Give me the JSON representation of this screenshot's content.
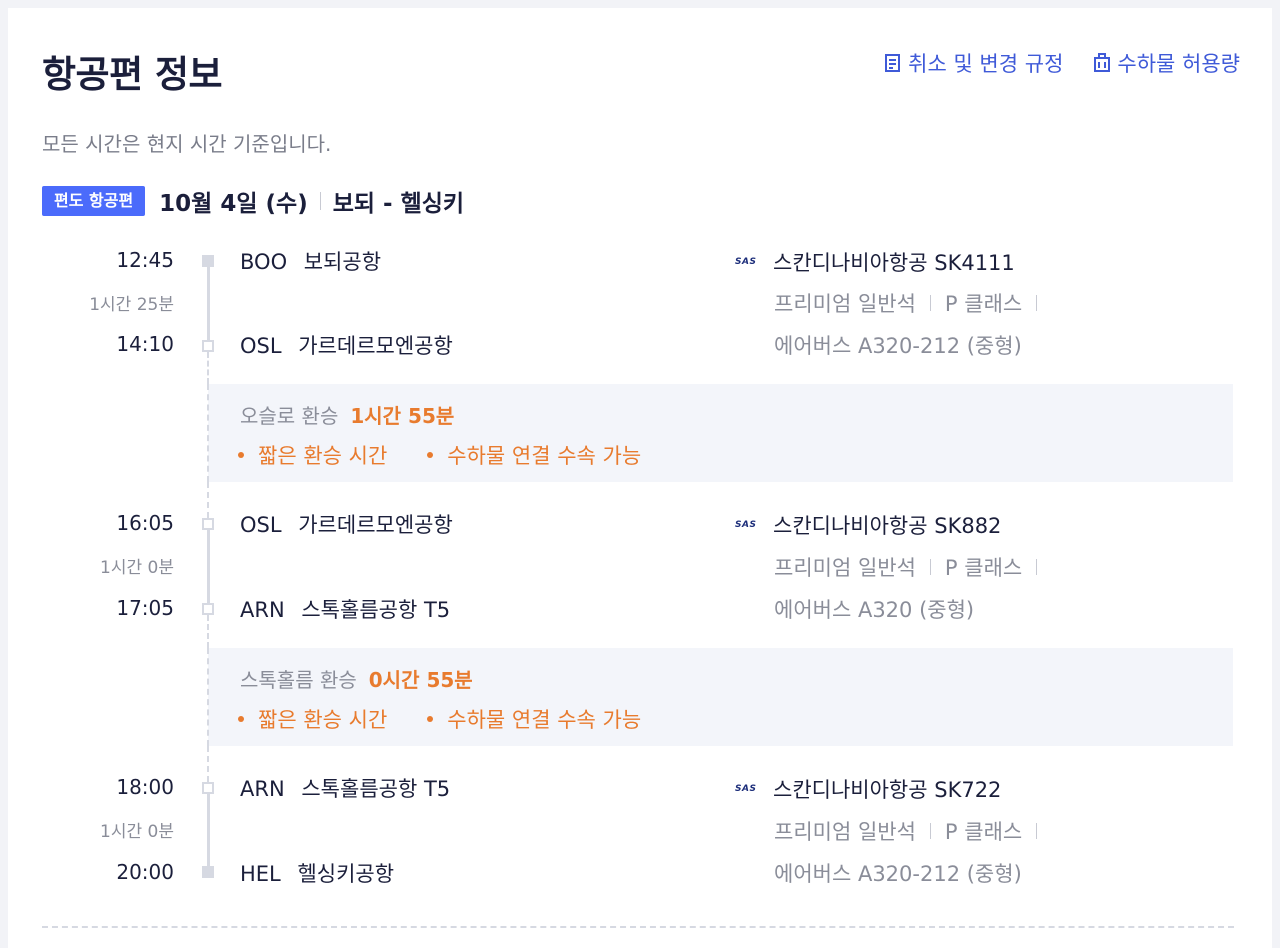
{
  "title": "항공편 정보",
  "links": {
    "cancel_policy": "취소 및 변경 규정",
    "baggage": "수하물 허용량"
  },
  "subtitle": "모든 시간은 현지 시간 기준입니다.",
  "header": {
    "badge": "편도 항공편",
    "date": "10월 4일 (수)",
    "route": "보되 - 헬싱키"
  },
  "segments": [
    {
      "dep_time": "12:45",
      "duration": "1시간 25분",
      "arr_time": "14:10",
      "dep_code": "BOO",
      "dep_name": "보되공항",
      "arr_code": "OSL",
      "arr_name": "가르데르모엔공항",
      "logo": "SAS",
      "airline": "스칸디나비아항공 SK4111",
      "cabin": "프리미엄 일반석",
      "class": "P 클래스",
      "aircraft": "에어버스 A320-212 (중형)"
    },
    {
      "dep_time": "16:05",
      "duration": "1시간 0분",
      "arr_time": "17:05",
      "dep_code": "OSL",
      "dep_name": "가르데르모엔공항",
      "arr_code": "ARN",
      "arr_name": "스톡홀름공항 T5",
      "logo": "SAS",
      "airline": "스칸디나비아항공 SK882",
      "cabin": "프리미엄 일반석",
      "class": "P 클래스",
      "aircraft": "에어버스 A320 (중형)"
    },
    {
      "dep_time": "18:00",
      "duration": "1시간 0분",
      "arr_time": "20:00",
      "dep_code": "ARN",
      "dep_name": "스톡홀름공항 T5",
      "arr_code": "HEL",
      "arr_name": "헬싱키공항",
      "logo": "SAS",
      "airline": "스칸디나비아항공 SK722",
      "cabin": "프리미엄 일반석",
      "class": "P 클래스",
      "aircraft": "에어버스 A320-212 (중형)"
    }
  ],
  "layovers": [
    {
      "label": "오슬로 환승",
      "duration": "1시간 55분",
      "note1": "짧은 환승 시간",
      "note2": "수하물 연결 수속 가능"
    },
    {
      "label": "스톡홀름 환승",
      "duration": "0시간 55분",
      "note1": "짧은 환승 시간",
      "note2": "수하물 연결 수속 가능"
    }
  ],
  "colors": {
    "accent": "#3f5ad8",
    "badge": "#4b6bfb",
    "warning": "#e87b2e"
  }
}
